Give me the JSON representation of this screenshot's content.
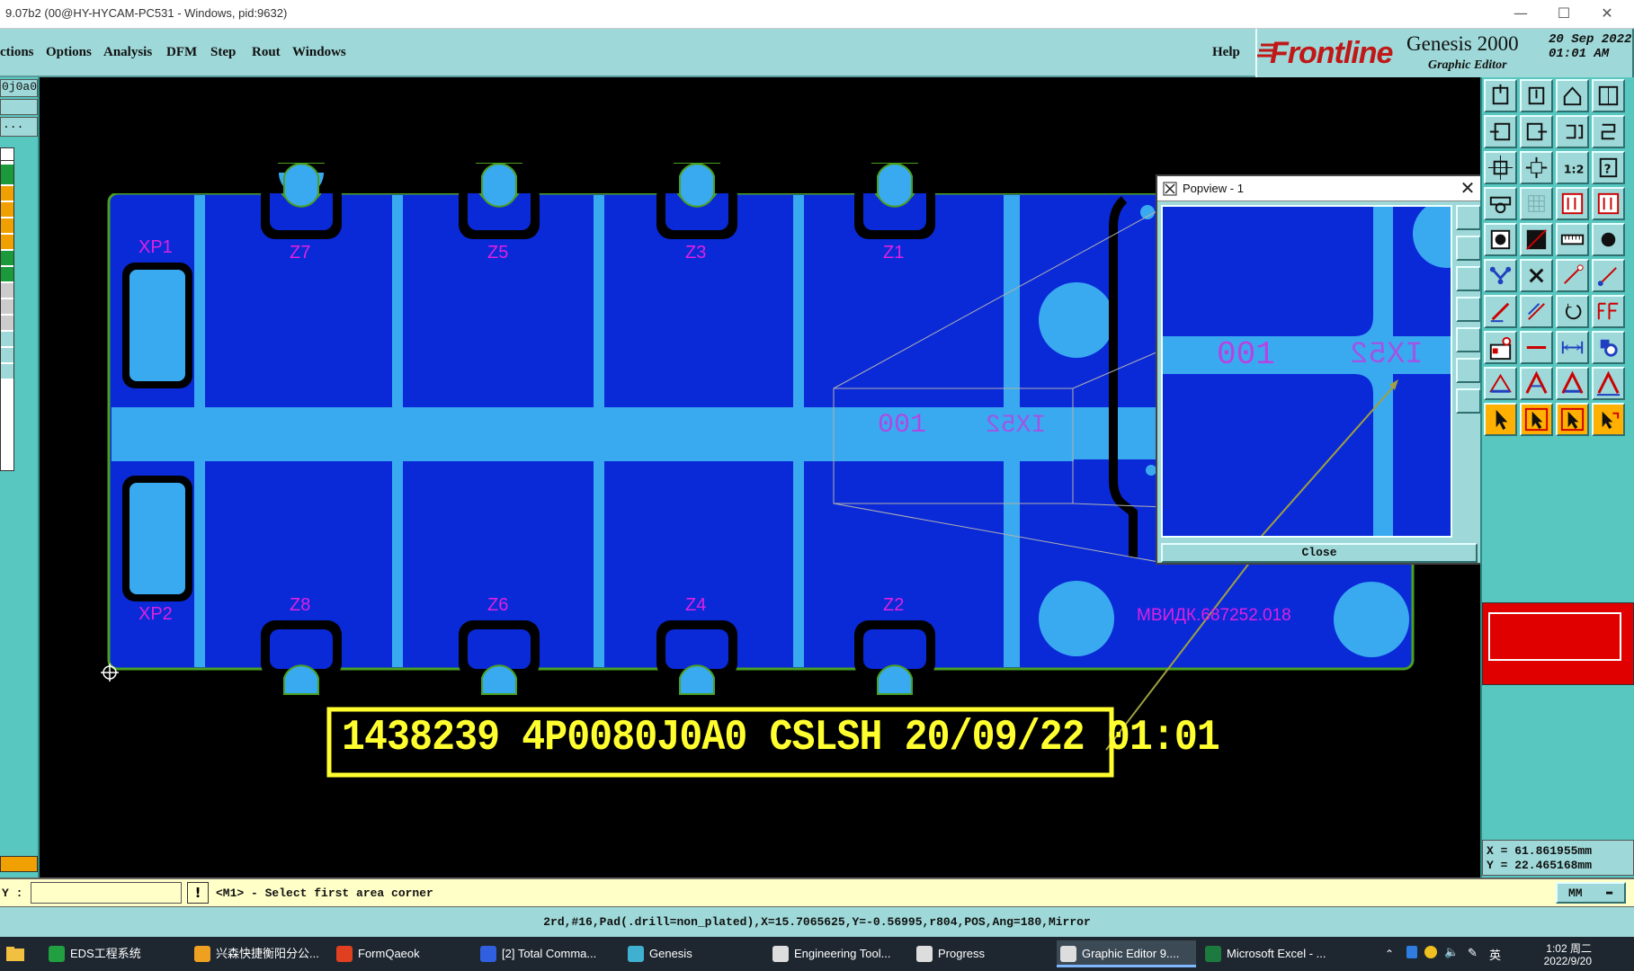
{
  "window": {
    "title": "9.07b2 (00@HY-HYCAM-PC531 - Windows, pid:9632)",
    "minimize": "—",
    "maximize": "☐",
    "close": "✕"
  },
  "menu": {
    "items": [
      "ctions",
      "Options",
      "Analysis",
      "DFM",
      "Step",
      "Rout",
      "Windows"
    ],
    "help": "Help"
  },
  "brand": {
    "logo": "Frontline",
    "product": "Genesis 2000",
    "subtitle": "Graphic Editor",
    "date": "20 Sep 2022",
    "time": "01:01 AM",
    "accent": "#c01818"
  },
  "left_panel": {
    "job_field": "0j0a0",
    "step_field": "..."
  },
  "board": {
    "labels_top": [
      "Z7",
      "Z5",
      "Z3",
      "Z1"
    ],
    "labels_bottom": [
      "Z8",
      "Z6",
      "Z4",
      "Z2"
    ],
    "connector_top": "XP1",
    "connector_bottom": "XP2",
    "part_number": "МВИДК.687252.018",
    "silkscreen_code": "001",
    "silkscreen_mirror": "IX52",
    "stamp": "1438239 4P0080J0A0 CSLSH 20/09/22 01:01",
    "colors": {
      "copper": "#0a2ad8",
      "pad": "#3aaaf0",
      "outline": "#4aa020",
      "label": "#e020e0",
      "stamp": "#ffff30"
    }
  },
  "popview": {
    "title": "Popview - 1",
    "close_label": "Close",
    "code": "001",
    "mirror": "IX52"
  },
  "coords": {
    "x": "X =  61.861955mm",
    "y": "Y =  22.465168mm"
  },
  "command": {
    "label": "Y :",
    "input_value": "",
    "warn": "!",
    "prompt": "<M1> - Select first area corner",
    "units": "MM"
  },
  "status_info": "2rd,#16,Pad(.drill=non_plated),X=15.7065625,Y=-0.56995,r804,POS,Ang=180,Mirror",
  "taskbar": {
    "items": [
      {
        "label": "EDS工程系统",
        "icon": "eds-icon",
        "active": false
      },
      {
        "label": "兴森快捷衡阳分公...",
        "icon": "company-icon",
        "active": false
      },
      {
        "label": "FormQaeok",
        "icon": "form-icon",
        "active": false
      },
      {
        "label": "[2] Total Comma...",
        "icon": "total-commander-icon",
        "active": false
      },
      {
        "label": "Genesis",
        "icon": "genesis-icon",
        "active": false
      },
      {
        "label": "Engineering Tool...",
        "icon": "tool-icon",
        "active": false
      },
      {
        "label": "Progress",
        "icon": "progress-icon",
        "active": false
      },
      {
        "label": "Graphic Editor 9....",
        "icon": "graphic-editor-icon",
        "active": true
      },
      {
        "label": "Microsoft Excel - ...",
        "icon": "excel-icon",
        "active": false
      }
    ],
    "tray": {
      "ime": "英",
      "time": "1:02 周二",
      "date": "2022/9/20"
    }
  }
}
